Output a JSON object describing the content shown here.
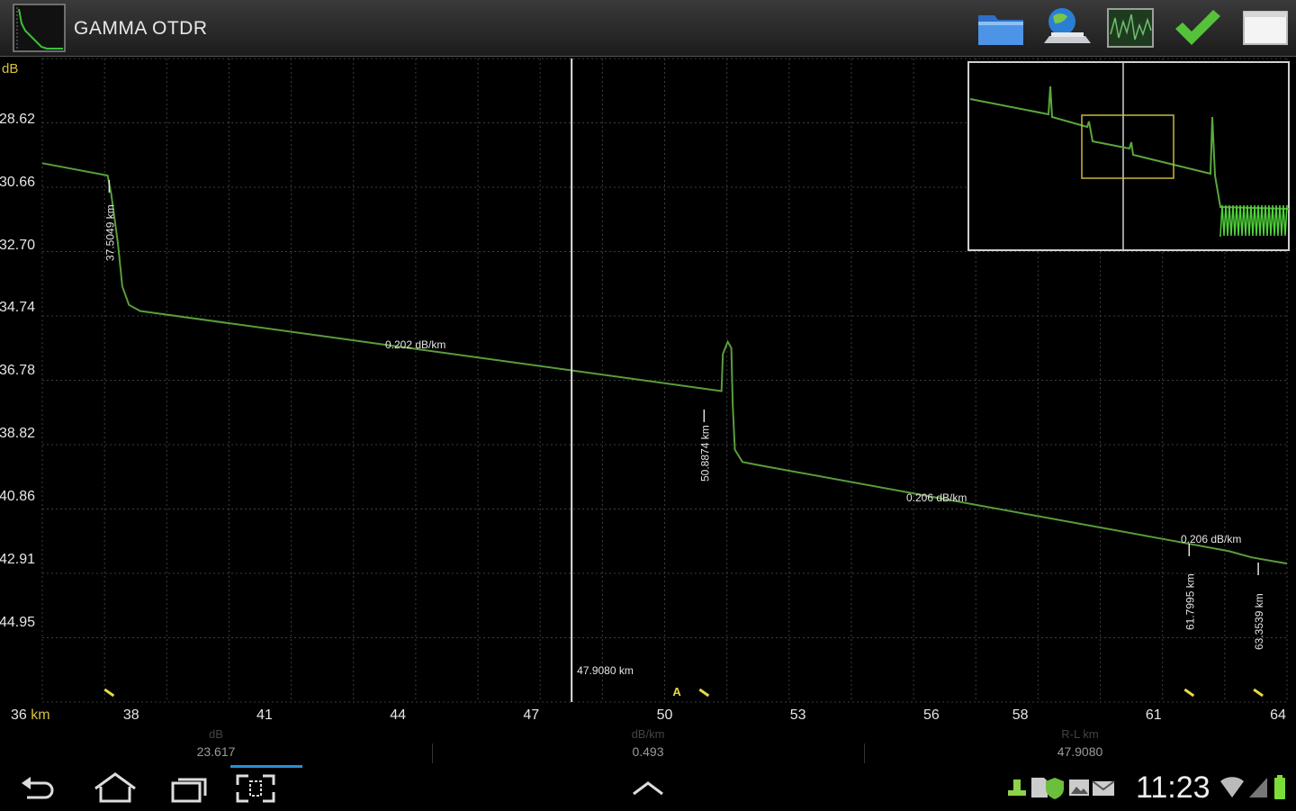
{
  "app": {
    "title": "GAMMA OTDR",
    "toolbar": [
      {
        "name": "open-folder-button",
        "icon": "folder-icon"
      },
      {
        "name": "network-button",
        "icon": "globe-network-icon"
      },
      {
        "name": "trace-view-button",
        "icon": "oscilloscope-icon"
      },
      {
        "name": "accept-button",
        "icon": "checkmark-icon"
      },
      {
        "name": "window-button",
        "icon": "window-icon"
      }
    ]
  },
  "chart_data": {
    "type": "line",
    "ylabel": "dB",
    "xunit": "km",
    "xlim": [
      36,
      64
    ],
    "ylim": [
      26.6,
      47.5
    ],
    "ylim_inverted": true,
    "yticks": [
      "28.62",
      "30.66",
      "32.70",
      "34.74",
      "36.78",
      "38.82",
      "40.86",
      "42.91",
      "44.95"
    ],
    "xticks": [
      "36",
      "38",
      "41",
      "44",
      "47",
      "50",
      "53",
      "56",
      "58",
      "61",
      "64"
    ],
    "series": [
      {
        "x": [
          36.0,
          37.47,
          37.55,
          37.7,
          37.8,
          37.95,
          38.2,
          51.28,
          51.31,
          51.42,
          51.5,
          51.53,
          51.58,
          51.75,
          52.1,
          61.2,
          62.7,
          63.2,
          64.0
        ],
        "y": [
          30.0,
          30.4,
          31.0,
          32.6,
          34.0,
          34.6,
          34.8,
          37.4,
          36.2,
          35.8,
          36.0,
          37.8,
          39.3,
          39.7,
          39.8,
          42.2,
          42.6,
          42.8,
          43.0
        ]
      }
    ],
    "cursor": {
      "x": 47.908,
      "label": "47.9080 km"
    },
    "events": [
      {
        "x": 37.5049,
        "label": "37.5049 km"
      },
      {
        "x": 50.8874,
        "label": "50.8874 km"
      },
      {
        "x": 61.7995,
        "label": "61.7995 km"
      },
      {
        "x": 63.3539,
        "label": "63.3539 km"
      }
    ],
    "slopes": [
      "0.202 dB/km",
      "0.206 dB/km",
      "0.206 dB/km"
    ],
    "marker_a": "A"
  },
  "readouts": {
    "db_label": "dB",
    "db_value": "23.617",
    "slope_label": "dB/km",
    "slope_value": "0.493",
    "dist_label": "R-L km",
    "dist_value": "47.9080"
  },
  "status": {
    "time": "11:23"
  }
}
